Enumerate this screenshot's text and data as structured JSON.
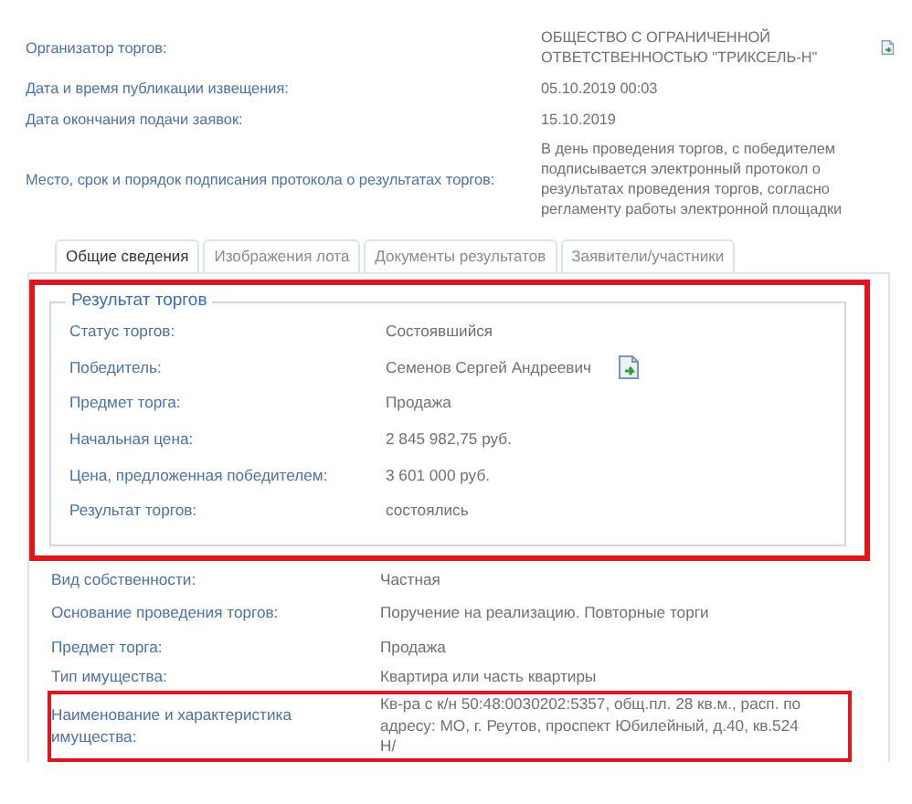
{
  "details": [
    {
      "label": "Организатор торгов:",
      "value": "ОБЩЕСТВО С ОГРАНИЧЕННОЙ ОТВЕТСТВЕННОСТЬЮ \"ТРИКСЕЛЬ-Н\"",
      "icon": true
    },
    {
      "label": "Дата и время публикации извещения:",
      "value": "05.10.2019 00:03",
      "icon": false
    },
    {
      "label": "Дата окончания подачи заявок:",
      "value": "15.10.2019",
      "icon": false
    },
    {
      "label": "Место, срок и порядок подписания протокола о результатах торгов:",
      "value": "В день проведения торгов, с победителем подписывается электронный протокол о результатах проведения торгов, согласно регламенту работы электронной площадки",
      "icon": false
    }
  ],
  "tabs": [
    {
      "label": "Общие сведения",
      "selected": true
    },
    {
      "label": "Изображения лота",
      "selected": false
    },
    {
      "label": "Документы результатов",
      "selected": false
    },
    {
      "label": "Заявители/участники",
      "selected": false
    }
  ],
  "result": {
    "title": "Результат торгов",
    "highlighted": true,
    "rows": [
      {
        "label": "Статус торгов:",
        "value": "Состоявшийся",
        "icon": false
      },
      {
        "label": "Победитель:",
        "value": "Семенов Сергей Андреевич",
        "icon": true
      },
      {
        "label": "Предмет торга:",
        "value": "Продажа",
        "icon": false
      },
      {
        "label": "Начальная цена:",
        "value": "2 845 982,75 руб.",
        "icon": false
      },
      {
        "label": "Цена, предложенная победителем:",
        "value": "3 601 000 руб.",
        "icon": false
      },
      {
        "label": "Результат торгов:",
        "value": "состоялись",
        "icon": false
      }
    ]
  },
  "lot": [
    {
      "label": "Вид собственности:",
      "value": "Частная",
      "highlighted": false
    },
    {
      "label": "Основание проведения торгов:",
      "value": "Поручение на реализацию. Повторные торги",
      "highlighted": false
    },
    {
      "label": "Предмет торга:",
      "value": "Продажа",
      "highlighted": false
    },
    {
      "label": "Тип имущества:",
      "value": "Квартира или часть квартиры",
      "highlighted": false
    },
    {
      "label": "Наименование и характеристика имущества:",
      "value": "Кв-ра с к/н 50:48:0030202:5357, общ.пл. 28 кв.м., расп. по адресу: МО, г. Реутов, проспект Юбилейный, д.40, кв.524 Н/",
      "highlighted": true
    }
  ]
}
